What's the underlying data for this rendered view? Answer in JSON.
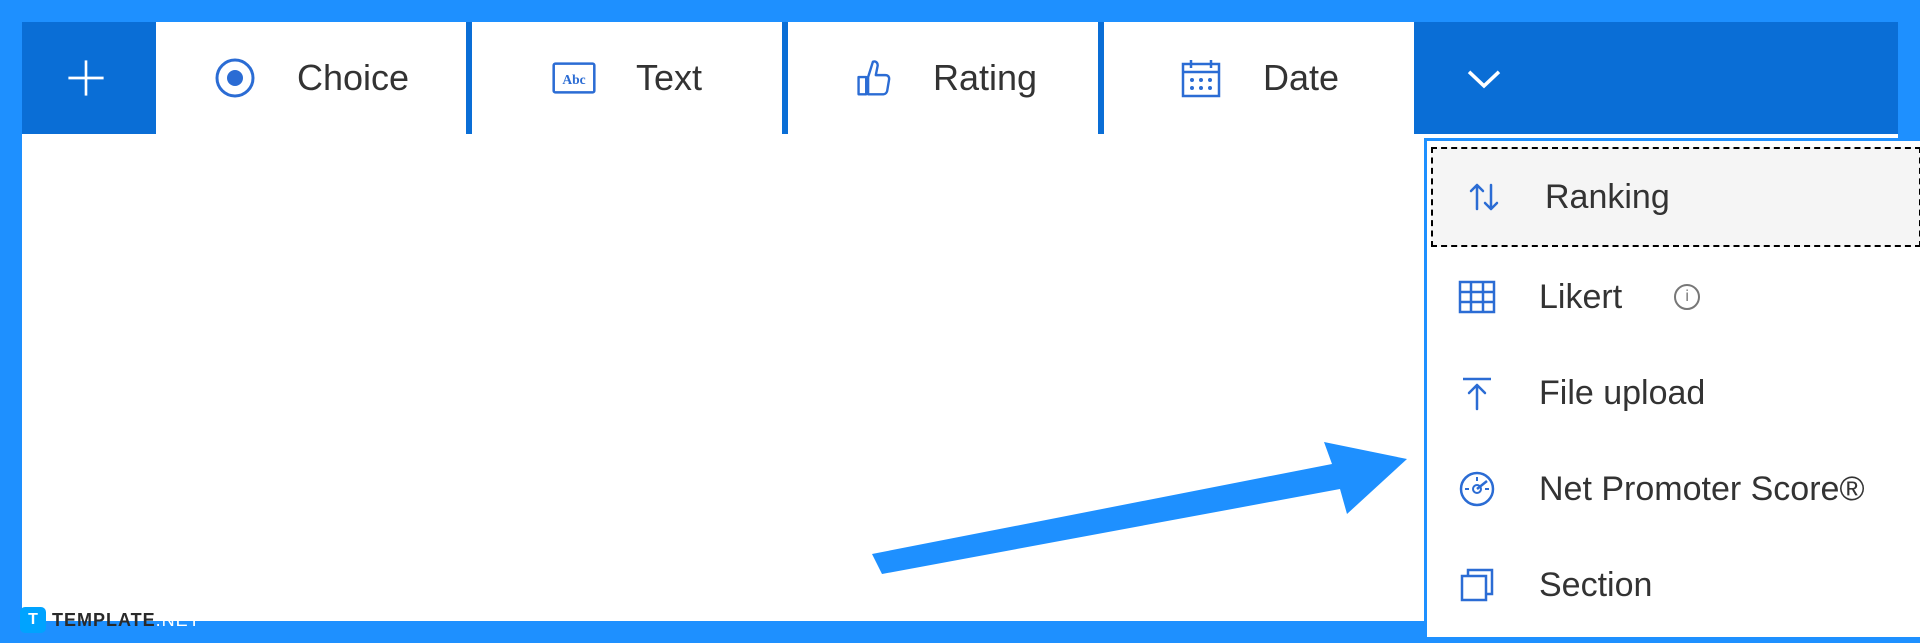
{
  "toolbar": {
    "buttons": [
      {
        "id": "choice",
        "label": "Choice"
      },
      {
        "id": "text",
        "label": "Text"
      },
      {
        "id": "rating",
        "label": "Rating"
      },
      {
        "id": "date",
        "label": "Date"
      }
    ]
  },
  "dropdown": {
    "items": [
      {
        "id": "ranking",
        "label": "Ranking",
        "highlighted": true
      },
      {
        "id": "likert",
        "label": "Likert",
        "info": true
      },
      {
        "id": "file-upload",
        "label": "File upload"
      },
      {
        "id": "nps",
        "label": "Net Promoter Score®"
      },
      {
        "id": "section",
        "label": "Section"
      }
    ]
  },
  "watermark": {
    "badge": "T",
    "text_bold": "TEMPLATE",
    "text_light": ".NET"
  },
  "colors": {
    "primary": "#0a6ed6",
    "accent_bg": "#1e90ff",
    "icon": "#2b6cd4"
  }
}
